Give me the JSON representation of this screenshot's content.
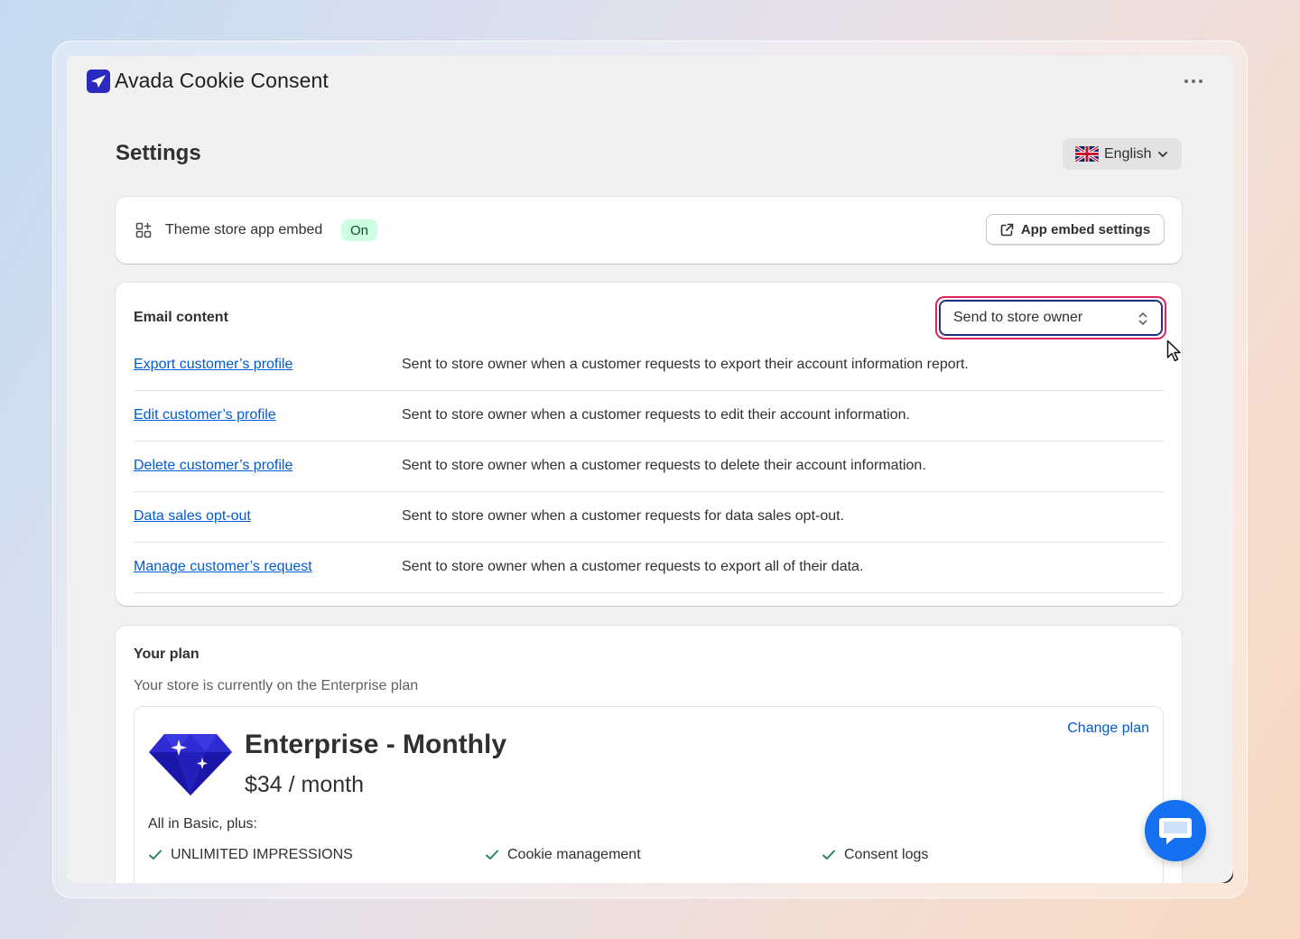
{
  "app": {
    "title": "Avada Cookie Consent",
    "brand_color": "#2a2abf"
  },
  "page": {
    "title": "Settings",
    "language": "English"
  },
  "embed": {
    "label": "Theme store app embed",
    "status": "On",
    "button_label": "App embed settings"
  },
  "email": {
    "heading": "Email content",
    "select_value": "Send to store owner",
    "rows": [
      {
        "link": "Export customer’s profile",
        "desc": "Sent to store owner when a customer requests to export their account information report."
      },
      {
        "link": "Edit customer’s profile",
        "desc": "Sent to store owner when a customer requests to edit their account information."
      },
      {
        "link": "Delete customer’s profile",
        "desc": "Sent to store owner when a customer requests to delete their account information."
      },
      {
        "link": "Data sales opt-out",
        "desc": "Sent to store owner when a customer requests for data sales opt-out."
      },
      {
        "link": "Manage customer’s request",
        "desc": "Sent to store owner when a customer requests to export all of their data."
      }
    ]
  },
  "plan": {
    "heading": "Your plan",
    "subtitle": "Your store is currently on the Enterprise plan",
    "name": "Enterprise - Monthly",
    "price": "$34 / month",
    "change_label": "Change plan",
    "includes_label": "All in Basic, plus:",
    "features": [
      "UNLIMITED IMPRESSIONS",
      "Cookie management",
      "Consent logs"
    ]
  }
}
